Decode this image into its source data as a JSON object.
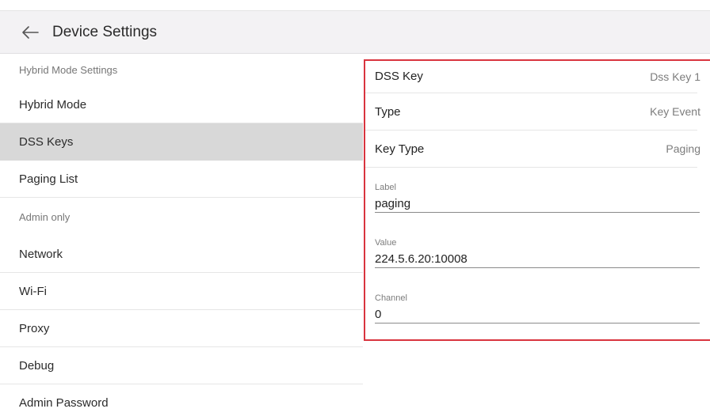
{
  "header": {
    "title": "Device Settings",
    "back_icon": "arrow-left-icon"
  },
  "sidebar": {
    "items": [
      {
        "label": "Hybrid Mode Settings",
        "kind": "section"
      },
      {
        "label": "Hybrid Mode",
        "kind": "item"
      },
      {
        "label": "DSS Keys",
        "kind": "item",
        "selected": true
      },
      {
        "label": "Paging List",
        "kind": "item"
      },
      {
        "label": "Admin only",
        "kind": "section"
      },
      {
        "label": "Network",
        "kind": "item"
      },
      {
        "label": "Wi-Fi",
        "kind": "item"
      },
      {
        "label": "Proxy",
        "kind": "item"
      },
      {
        "label": "Debug",
        "kind": "item"
      },
      {
        "label": "Admin Password",
        "kind": "item"
      }
    ]
  },
  "panel": {
    "rows": [
      {
        "key": "DSS Key",
        "value": "Dss Key 1"
      },
      {
        "key": "Type",
        "value": "Key Event"
      },
      {
        "key": "Key Type",
        "value": "Paging"
      }
    ],
    "fields": [
      {
        "label": "Label",
        "value": "paging"
      },
      {
        "label": "Value",
        "value": "224.5.6.20:10008"
      },
      {
        "label": "Channel",
        "value": "0"
      }
    ]
  },
  "colors": {
    "highlight_border": "#d9343f",
    "header_bg": "#f3f2f4",
    "selected_bg": "#d8d8d8"
  }
}
